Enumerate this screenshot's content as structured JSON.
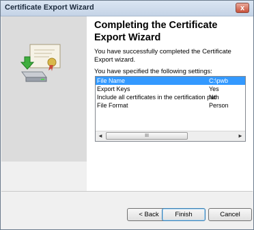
{
  "window": {
    "title": "Certificate Export Wizard",
    "close_label": "x"
  },
  "page": {
    "heading": "Completing the Certificate Export Wizard",
    "message": "You have successfully completed the Certificate Export wizard.",
    "settings_label": "You have specified the following settings:"
  },
  "settings": {
    "rows": [
      {
        "name": "File Name",
        "value": "C:\\pwb"
      },
      {
        "name": "Export Keys",
        "value": "Yes"
      },
      {
        "name": "Include all certificates in the certification path",
        "value": "No"
      },
      {
        "name": "File Format",
        "value": "Person"
      }
    ],
    "selected_index": 0
  },
  "scrollbar": {
    "left_arrow": "◄",
    "right_arrow": "►",
    "grip": "III"
  },
  "buttons": {
    "back": "< Back",
    "finish": "Finish",
    "cancel": "Cancel"
  },
  "colors": {
    "selection": "#3399ff",
    "left_panel": "#dcdcdc"
  }
}
